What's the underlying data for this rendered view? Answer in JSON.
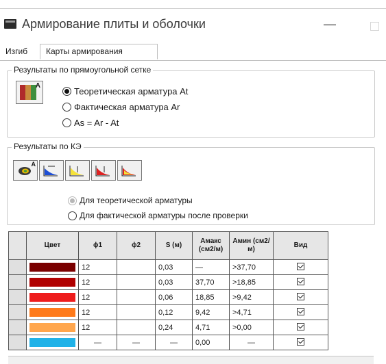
{
  "window": {
    "title": "Армирование плиты и оболочки",
    "minimize_label": "—"
  },
  "tabs": [
    {
      "label": "Изгиб"
    },
    {
      "label": "Карты армирования"
    }
  ],
  "group_grid": {
    "title": "Результаты по прямоугольной сетке",
    "icon": "grid-results-icon",
    "options": [
      {
        "label": "Теоретическая арматура At",
        "selected": true
      },
      {
        "label": "Фактическая арматура Ar",
        "selected": false
      },
      {
        "label": "As = Ar - At",
        "selected": false
      }
    ]
  },
  "group_fe": {
    "title": "Результаты по КЭ",
    "toolbar_icons": [
      "fe-map-icon",
      "fe-diagram-icon",
      "fe-diagram-2-icon",
      "fe-diagram-3-icon",
      "fe-diagram-4-icon"
    ],
    "options": [
      {
        "label": "Для теоретической арматуры",
        "selected": true,
        "disabled": true
      },
      {
        "label": "Для фактической арматуры после проверки",
        "selected": false,
        "disabled": false
      }
    ]
  },
  "table": {
    "columns": [
      "Цвет",
      "ϕ1",
      "ϕ2",
      "S (м)",
      "Амакс (см2/м)",
      "Амин (см2/м)",
      "Вид"
    ],
    "rows": [
      {
        "color": "#7a0000",
        "d1": "12",
        "d2": "",
        "s": "0,03",
        "amax": "—",
        "amin": ">37,70",
        "visible": true
      },
      {
        "color": "#b00000",
        "d1": "12",
        "d2": "",
        "s": "0,03",
        "amax": "37,70",
        "amin": ">18,85",
        "visible": true
      },
      {
        "color": "#ee1c1c",
        "d1": "12",
        "d2": "",
        "s": "0,06",
        "amax": "18,85",
        "amin": ">9,42",
        "visible": true
      },
      {
        "color": "#ff7a1a",
        "d1": "12",
        "d2": "",
        "s": "0,12",
        "amax": "9,42",
        "amin": ">4,71",
        "visible": true
      },
      {
        "color": "#ffa64d",
        "d1": "12",
        "d2": "",
        "s": "0,24",
        "amax": "4,71",
        "amin": ">0,00",
        "visible": true
      },
      {
        "color": "#1fb2e8",
        "d1": "—",
        "d2": "—",
        "s": "—",
        "amax": "0,00",
        "amin": "—",
        "visible": true
      }
    ]
  }
}
